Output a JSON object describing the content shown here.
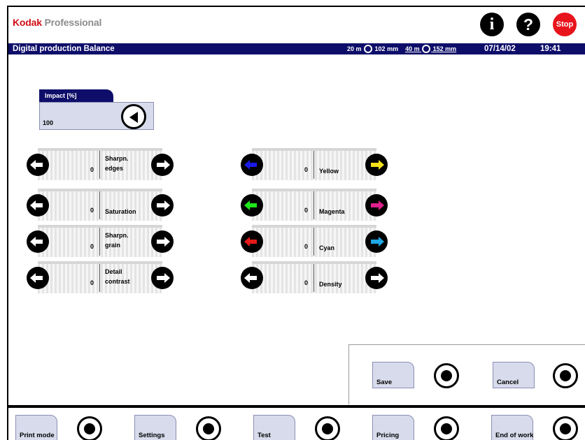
{
  "brand": {
    "name_1": "Kodak",
    "name_2": "Professional"
  },
  "header_buttons": {
    "info": "i",
    "help": "?",
    "stop": "Stop"
  },
  "titlebar": {
    "title": "Digital production Balance",
    "media_1": "20 m",
    "media_1_size": "102 mm",
    "media_2": "40 m",
    "media_2_size": "152 mm",
    "date": "07/14/02",
    "time": "19:41"
  },
  "impact": {
    "label": "Impact [%]",
    "value": "100"
  },
  "adjustments_left": [
    {
      "value": "0",
      "label_1": "Sharpn.",
      "label_2": "edges"
    },
    {
      "value": "0",
      "label_1": "Saturation",
      "label_2": ""
    },
    {
      "value": "0",
      "label_1": "Sharpn.",
      "label_2": "grain"
    },
    {
      "value": "0",
      "label_1": "Detail",
      "label_2": "contrast"
    }
  ],
  "adjustments_right": [
    {
      "value": "0",
      "label_1": "Yellow",
      "left_color": "#1a1ae6",
      "right_color": "#f5e21b"
    },
    {
      "value": "0",
      "label_1": "Magenta",
      "left_color": "#1ee61a",
      "right_color": "#e0208c"
    },
    {
      "value": "0",
      "label_1": "Cyan",
      "left_color": "#e61a1a",
      "right_color": "#20a8e6"
    },
    {
      "value": "0",
      "label_1": "Density",
      "left_color": "#ffffff",
      "right_color": "#ffffff"
    }
  ],
  "actions": {
    "save": "Save",
    "cancel": "Cancel"
  },
  "nav": {
    "print_mode": "Print mode",
    "settings": "Settings",
    "test": "Test",
    "pricing": "Pricing",
    "end_of_work": "End of work"
  }
}
